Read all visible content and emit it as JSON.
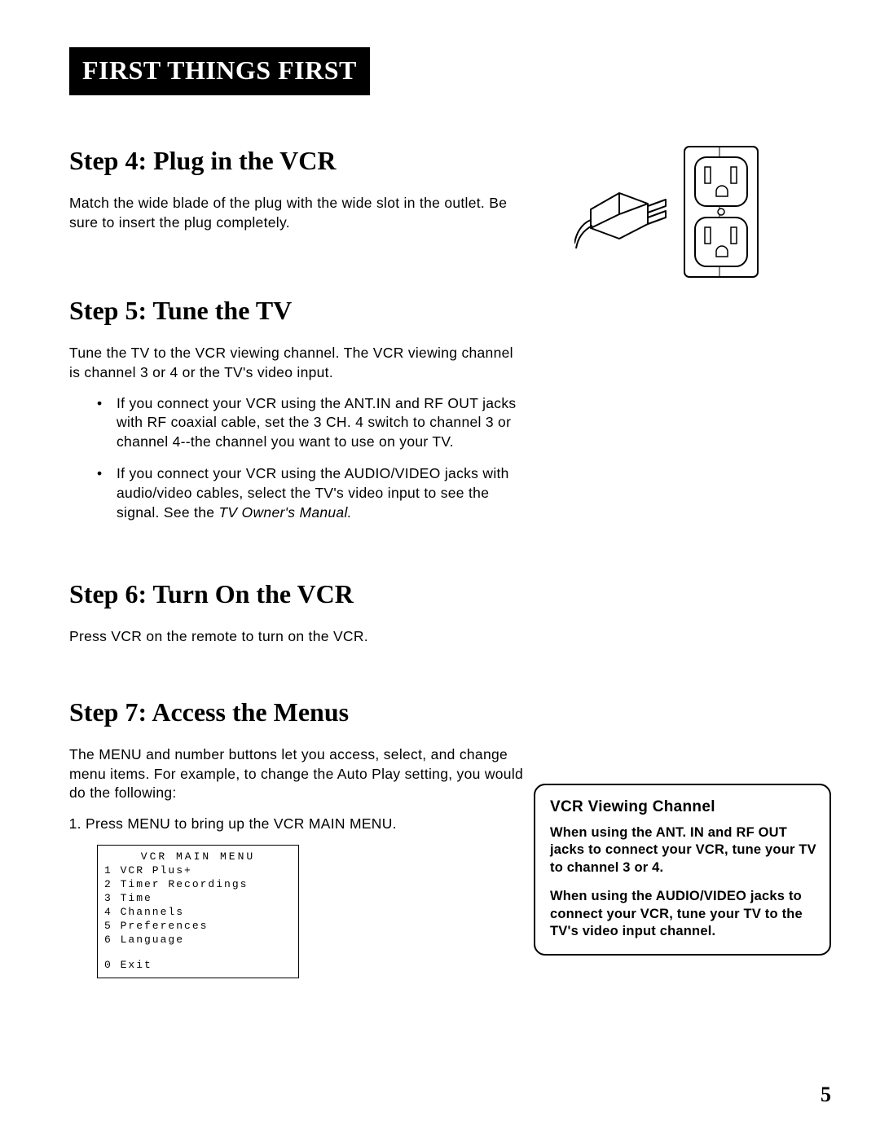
{
  "header": "FIRST THINGS FIRST",
  "step4": {
    "title": "Step 4: Plug in the VCR",
    "para": "Match the wide blade of the plug with the wide slot in the outlet. Be sure to insert the plug completely."
  },
  "step5": {
    "title": "Step 5: Tune the TV",
    "para": "Tune the TV to the VCR viewing channel. The VCR viewing channel is channel 3 or 4 or the TV's video input.",
    "b1a": "If you connect your VCR using the ANT.IN and RF OUT jacks with RF coaxial cable, set the 3 CH. 4 switch to channel 3 or channel 4--the channel you want to use on your TV.",
    "b2a": "If you connect your VCR using the AUDIO/VIDEO jacks with audio/video cables, select the TV's video input to see the signal. See the ",
    "b2b": "TV Owner's Manual."
  },
  "step6": {
    "title": "Step 6: Turn On the VCR",
    "para": "Press VCR on the remote to turn on the VCR."
  },
  "step7": {
    "title": "Step 7: Access the Menus",
    "para": "The MENU and number buttons let you access, select, and change menu items. For example, to change the Auto Play setting, you would do the following:",
    "n1": "Press MENU to bring up the VCR MAIN MENU."
  },
  "menu": {
    "title": "VCR MAIN MENU",
    "i1": "1 VCR Plus+",
    "i2": "2 Timer Recordings",
    "i3": "3 Time",
    "i4": "4 Channels",
    "i5": "5 Preferences",
    "i6": "6 Language",
    "exit": "0 Exit"
  },
  "callout": {
    "title": "VCR Viewing Channel",
    "p1": "When using the ANT. IN and RF OUT jacks to connect your VCR, tune your TV to channel 3 or 4.",
    "p2": "When using the AUDIO/VIDEO jacks to connect your VCR, tune your TV to the TV's video input channel."
  },
  "page_number": "5"
}
